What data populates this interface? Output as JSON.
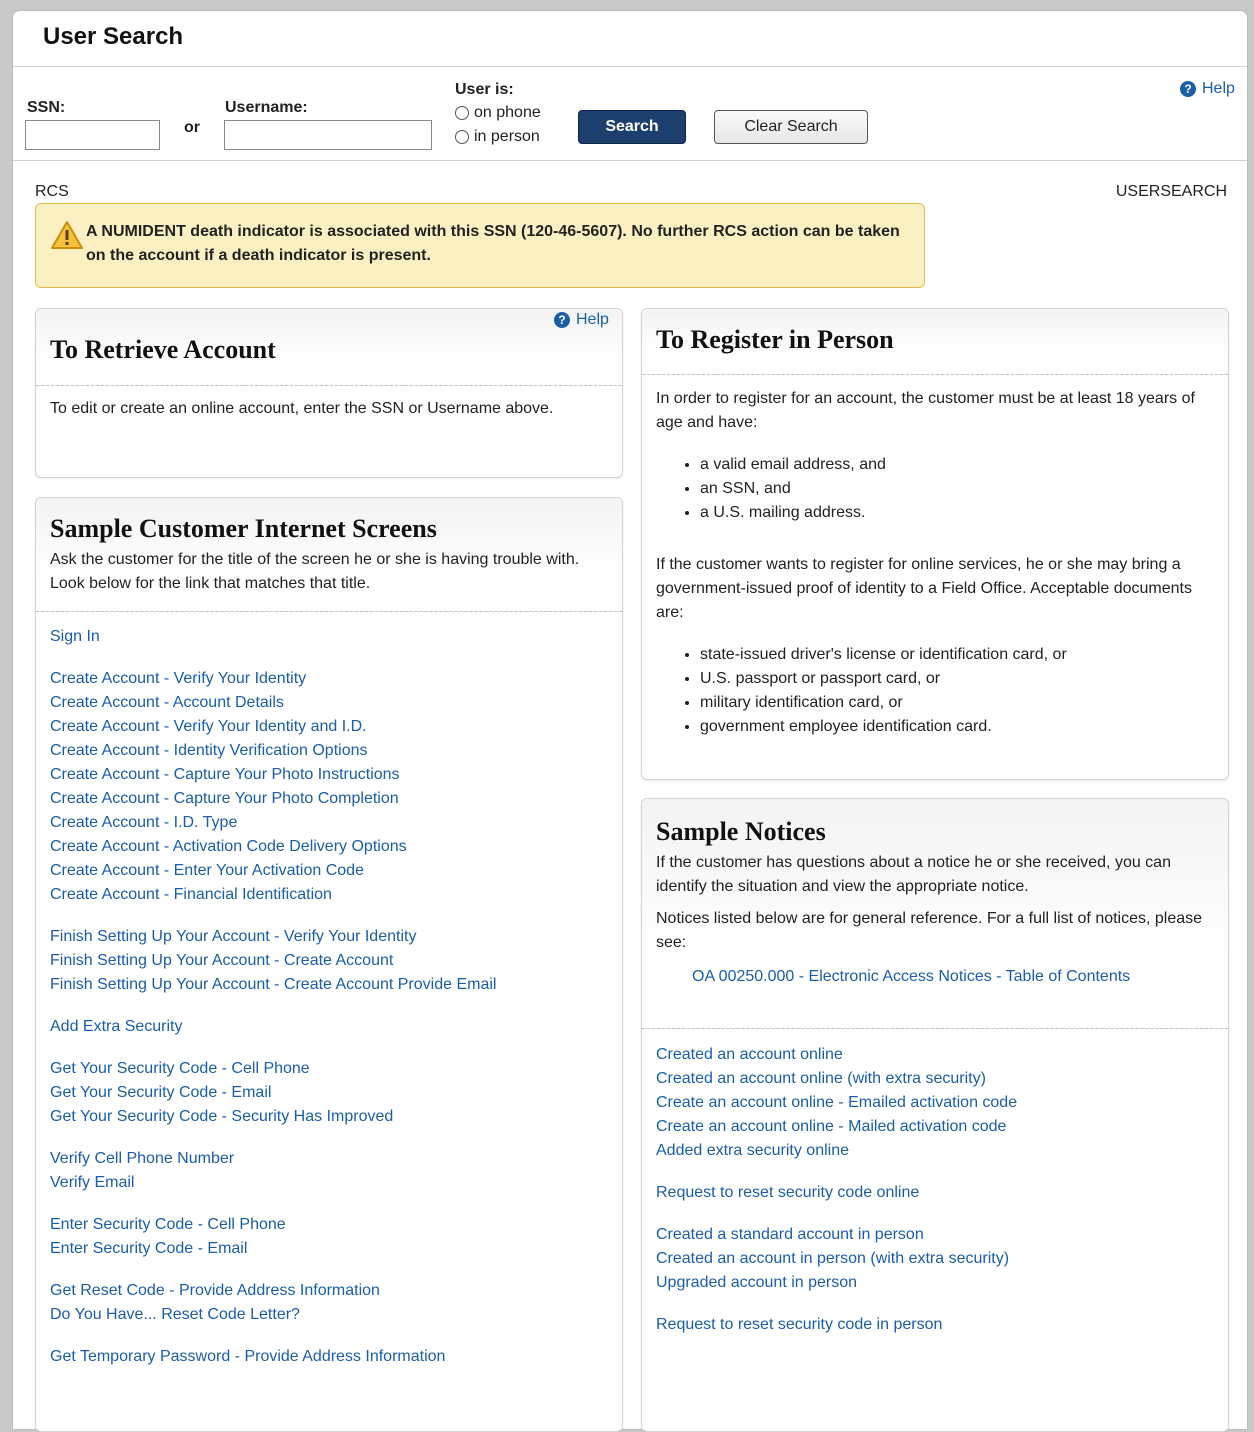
{
  "header": {
    "title": "User Search"
  },
  "search": {
    "ssn_label": "SSN:",
    "ssn_value": "",
    "or_text": "or",
    "username_label": "Username:",
    "username_value": "",
    "user_is_label": "User is:",
    "radio_on_phone": "on phone",
    "radio_in_person": "in person",
    "search_button": "Search",
    "clear_button": "Clear Search",
    "help": "Help"
  },
  "context": {
    "left": "RCS",
    "right": "USERSEARCH"
  },
  "alert": {
    "icon": "warning-icon",
    "text": "A NUMIDENT death indicator is associated with this SSN (120-46-5607). No further RCS action can be taken on the account if a death indicator is present."
  },
  "retrieve": {
    "title": "To Retrieve Account",
    "help": "Help",
    "body": "To edit or create an online account, enter the SSN or Username above."
  },
  "screens": {
    "title": "Sample Customer Internet Screens",
    "subtitle": "Ask the customer for the title of the screen he or she is having trouble with. Look below for the link that matches that title.",
    "groups": [
      [
        "Sign In"
      ],
      [
        "Create Account - Verify Your Identity",
        "Create Account - Account Details",
        "Create Account - Verify Your Identity and I.D.",
        "Create Account - Identity Verification Options",
        "Create Account - Capture Your Photo Instructions",
        "Create Account - Capture Your Photo Completion",
        "Create Account - I.D. Type",
        "Create Account - Activation Code Delivery Options",
        "Create Account - Enter Your Activation Code",
        "Create Account - Financial Identification"
      ],
      [
        "Finish Setting Up Your Account - Verify Your Identity",
        "Finish Setting Up Your Account - Create Account",
        "Finish Setting Up Your Account - Create Account Provide Email"
      ],
      [
        "Add Extra Security"
      ],
      [
        "Get Your Security Code - Cell Phone",
        "Get Your Security Code - Email",
        "Get Your Security Code - Security Has Improved"
      ],
      [
        "Verify Cell Phone Number",
        "Verify Email"
      ],
      [
        "Enter Security Code - Cell Phone",
        "Enter Security Code - Email"
      ],
      [
        "Get Reset Code - Provide Address Information",
        "Do You Have... Reset Code Letter?"
      ],
      [
        "Get Temporary Password - Provide Address Information"
      ]
    ]
  },
  "register": {
    "title": "To Register in Person",
    "intro": "In order to register for an account, the customer must be at least 18 years of age and have:",
    "requirements": [
      "a valid email address, and",
      "an SSN, and",
      "a U.S. mailing address."
    ],
    "field_office": "If the customer wants to register for online services, he or she may bring a government-issued proof of identity to a Field Office. Acceptable documents are:",
    "documents": [
      "state-issued driver's license or identification card, or",
      "U.S. passport or passport card, or",
      "military identification card, or",
      "government employee identification card."
    ]
  },
  "notices": {
    "title": "Sample Notices",
    "subtitle": "If the customer has questions about a notice he or she received, you can identify the situation and view the appropriate notice.",
    "reference": "Notices listed below are for general reference. For a full list of notices, please see:",
    "toc_link": "OA 00250.000 - Electronic Access Notices - Table of Contents",
    "groups": [
      [
        "Created an account online",
        "Created an account online (with extra security)",
        "Create an account online - Emailed activation code",
        "Create an account online - Mailed activation code",
        "Added extra security online"
      ],
      [
        "Request to reset security code online"
      ],
      [
        "Created a standard account in person",
        "Created an account in person (with extra security)",
        "Upgraded account in person"
      ],
      [
        "Request to reset security code in person"
      ]
    ]
  },
  "colors": {
    "link": "#1a5ea8",
    "primary_button": "#1c3f6e",
    "alert_bg": "#fbf0c1",
    "alert_border": "#e6b84b"
  }
}
